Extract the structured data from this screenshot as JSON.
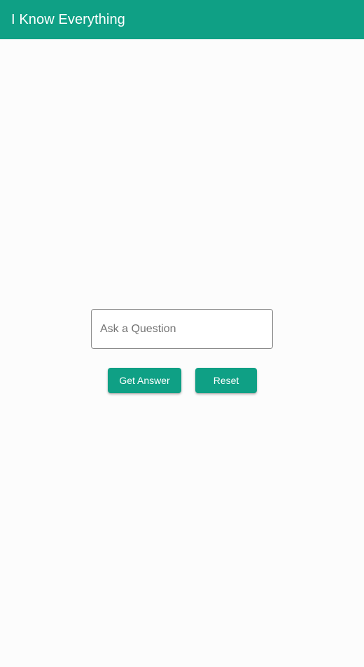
{
  "app_bar": {
    "title": "I Know Everything"
  },
  "form": {
    "question_placeholder": "Ask a Question",
    "question_value": "",
    "get_answer_label": "Get Answer",
    "reset_label": "Reset"
  },
  "colors": {
    "primary": "#0fa085",
    "background": "#fcfcfc",
    "button_text": "#ffffff"
  }
}
